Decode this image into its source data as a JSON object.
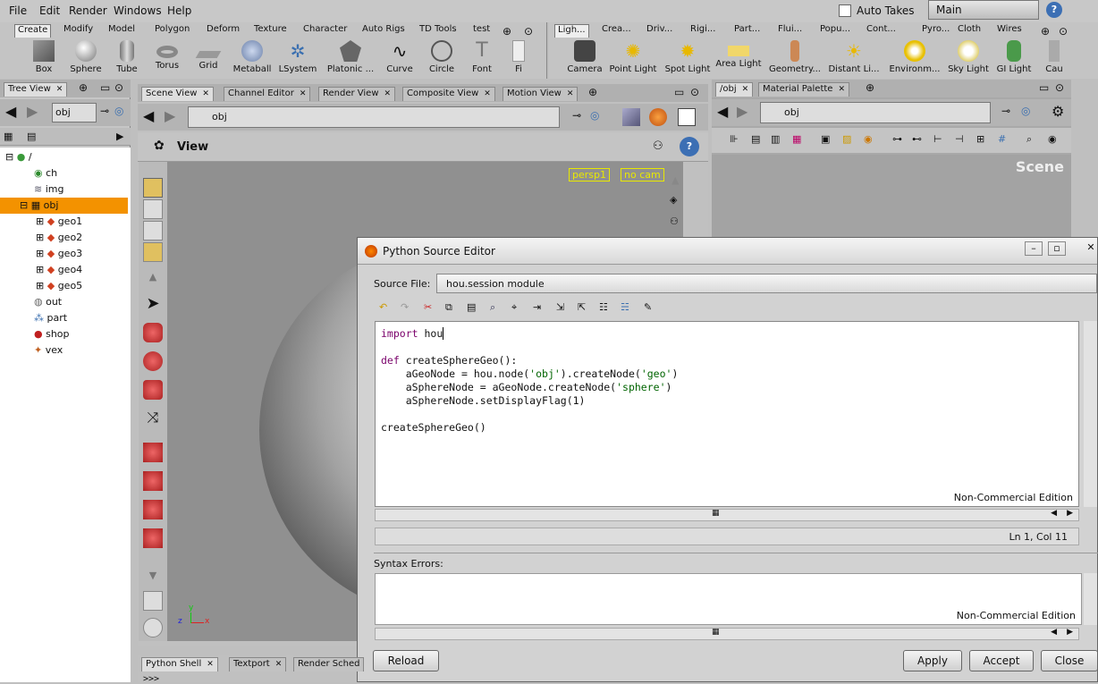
{
  "menu": {
    "file": "File",
    "edit": "Edit",
    "render": "Render",
    "windows": "Windows",
    "help": "Help"
  },
  "top_right": {
    "auto_takes": "Auto Takes",
    "desktop": "Main"
  },
  "shelf_left": {
    "tabs": [
      "Create",
      "Modify",
      "Model",
      "Polygon",
      "Deform",
      "Texture",
      "Character",
      "Auto Rigs",
      "TD Tools",
      "test"
    ],
    "tools": [
      "Box",
      "Sphere",
      "Tube",
      "Torus",
      "Grid",
      "Metaball",
      "LSystem",
      "Platonic ...",
      "Curve",
      "Circle",
      "Font",
      "Fi"
    ]
  },
  "shelf_right": {
    "tabs": [
      "Ligh...",
      "Crea...",
      "Driv...",
      "Rigi...",
      "Part...",
      "Flui...",
      "Popu...",
      "Cont...",
      "Pyro...",
      "Cloth",
      "Wires"
    ],
    "tools": [
      "Camera",
      "Point Light",
      "Spot Light",
      "Area Light",
      "Geometry...",
      "Distant Li...",
      "Environm...",
      "Sky Light",
      "GI Light",
      "Cau"
    ]
  },
  "tree_pane": {
    "tab": "Tree View",
    "path": "obj",
    "items": [
      "/",
      "ch",
      "img",
      "obj",
      "geo1",
      "geo2",
      "geo3",
      "geo4",
      "geo5",
      "out",
      "part",
      "shop",
      "vex"
    ]
  },
  "scene_pane": {
    "tabs": [
      "Scene View",
      "Channel Editor",
      "Render View",
      "Composite View",
      "Motion View"
    ],
    "path": "obj",
    "title": "View",
    "persp": "persp1",
    "cam": "no cam",
    "axis_y": "y",
    "axis_x": "x",
    "axis_z": "z"
  },
  "right_pane": {
    "tabs": [
      "/obj",
      "Material Palette"
    ],
    "path": "obj",
    "label": "Scene"
  },
  "python_editor": {
    "title": "Python Source Editor",
    "source_label": "Source File:",
    "source_value": "hou.session module",
    "code_lines": [
      "import hou",
      "",
      "def createSphereGeo():",
      "    aGeoNode = hou.node('obj').createNode('geo')",
      "    aSphereNode = aGeoNode.createNode('sphere')",
      "    aSphereNode.setDisplayFlag(1)",
      "",
      "createSphereGeo()"
    ],
    "edition": "Non-Commercial Edition",
    "status": "Ln 1, Col 11",
    "syntax_label": "Syntax Errors:",
    "edition2": "Non-Commercial Edition",
    "reload": "Reload",
    "apply": "Apply",
    "accept": "Accept",
    "close": "Close"
  },
  "bottom_pane": {
    "tabs": [
      "Python Shell",
      "Textport",
      "Render Sched"
    ],
    "prompt": ">>>"
  },
  "colors": {
    "selected": "#f39200",
    "persp_text": "#e8e800",
    "keyword": "#7a006a",
    "string": "#006400"
  }
}
